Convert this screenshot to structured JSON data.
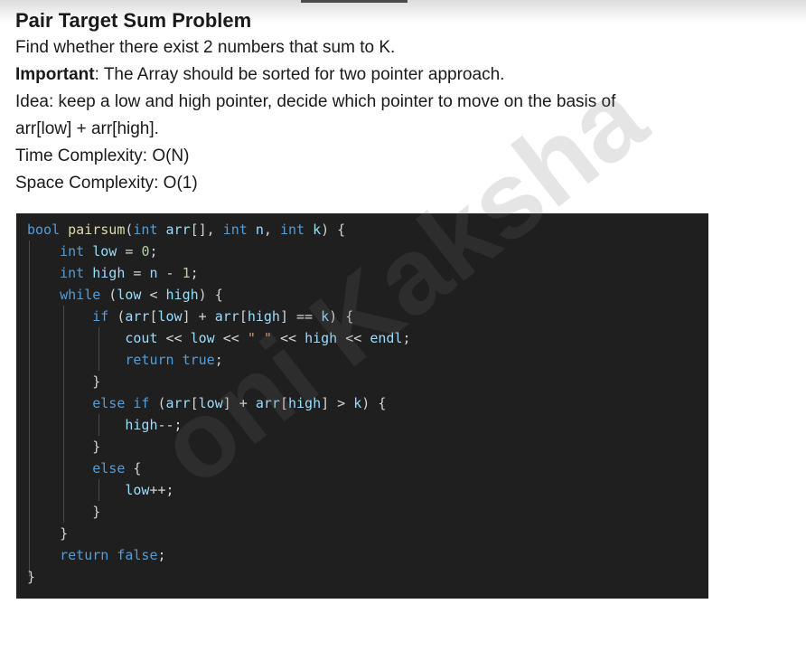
{
  "doc": {
    "title": "Pair Target Sum Problem",
    "line1": "Find whether there exist 2 numbers that sum to K.",
    "important_label": "Important",
    "important_text": ": The Array should be sorted for two pointer approach.",
    "idea_line1": "Idea: keep a low and high pointer, decide which pointer to move on the basis of",
    "idea_line2": "arr[low] + arr[high].",
    "time": "Time Complexity: O(N)",
    "space": "Space Complexity: O(1)"
  },
  "watermark": "oni Kaksha",
  "code": {
    "c1": {
      "kw": "bool",
      "fn": "pairsum",
      "a": "(",
      "t1": "int",
      "v1": "arr",
      "b": "[], ",
      "t2": "int",
      "v2": "n",
      "c": ", ",
      "t3": "int",
      "v3": "k",
      "d": ") {"
    },
    "c2": {
      "t": "int",
      "v": "low",
      "o": " = ",
      "n": "0",
      "e": ";"
    },
    "c3": {
      "t": "int",
      "v": "high",
      "o": " = ",
      "v2": "n",
      "o2": " - ",
      "n": "1",
      "e": ";"
    },
    "c4": {
      "kw": "while",
      "a": " (",
      "v1": "low",
      "o": " < ",
      "v2": "high",
      "e": ") {"
    },
    "c5": {
      "kw": "if",
      "a": " (",
      "v1": "arr",
      "b": "[",
      "v2": "low",
      "c": "] + ",
      "v3": "arr",
      "d": "[",
      "v4": "high",
      "e": "] == ",
      "v5": "k",
      "f": ") {"
    },
    "c6": {
      "v1": "cout",
      "o1": " << ",
      "v2": "low",
      "o2": " << ",
      "s": "\" \"",
      "o3": " << ",
      "v3": "high",
      "o4": " << ",
      "v4": "endl",
      "e": ";"
    },
    "c7": {
      "kw": "return",
      "sp": " ",
      "kw2": "true",
      "e": ";"
    },
    "c8": {
      "t": "}"
    },
    "c9": {
      "kw": "else",
      "sp": " ",
      "kw2": "if",
      "a": " (",
      "v1": "arr",
      "b": "[",
      "v2": "low",
      "c": "] + ",
      "v3": "arr",
      "d": "[",
      "v4": "high",
      "e": "] > ",
      "v5": "k",
      "f": ") {"
    },
    "c10": {
      "v": "high",
      "e": "--;"
    },
    "c11": {
      "t": "}"
    },
    "c12": {
      "kw": "else",
      "e": " {"
    },
    "c13": {
      "v": "low",
      "e": "++;"
    },
    "c14": {
      "t": "}"
    },
    "c15": {
      "t": "}"
    },
    "c16": {
      "kw": "return",
      "sp": " ",
      "kw2": "false",
      "e": ";"
    },
    "c17": {
      "t": "}"
    }
  }
}
